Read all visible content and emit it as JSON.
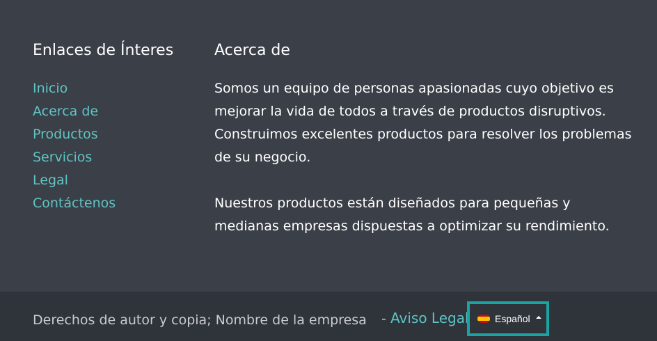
{
  "links_section": {
    "heading": "Enlaces de Ínteres",
    "items": [
      "Inicio",
      "Acerca de",
      "Productos",
      "Servicios",
      "Legal",
      "Contáctenos"
    ]
  },
  "about_section": {
    "heading": "Acerca de",
    "paragraph1": "Somos un equipo de personas apasionadas cuyo objetivo es mejorar la vida de todos a través de productos disruptivos. Construimos excelentes productos para resolver los problemas de su negocio.",
    "paragraph2": "Nuestros productos están diseñados para pequeñas y medianas empresas dispuestas a optimizar su rendimiento."
  },
  "footer": {
    "copyright": "Derechos de autor y copia; Nombre de la empresa",
    "separator": "-",
    "legal_link": "Aviso Legal",
    "language": {
      "flag_icon": "spain-flag-icon",
      "label": "Español",
      "caret_icon": "caret-up-icon"
    },
    "colors": {
      "link": "#5fc4c4",
      "highlight_border": "#1aa3a3"
    }
  }
}
